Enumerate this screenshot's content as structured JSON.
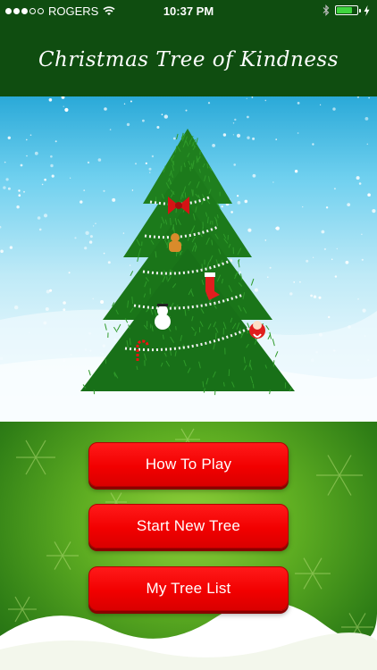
{
  "status_bar": {
    "carrier": "ROGERS",
    "time": "10:37 PM",
    "signal_strength": 3,
    "signal_max": 5,
    "battery_level": 0.75,
    "battery_color": "#3fd53f"
  },
  "header": {
    "title": "Christmas Tree of Kindness",
    "background": "#0f4d10"
  },
  "menu": {
    "how_to_play": "How To Play",
    "start_new_tree": "Start New Tree",
    "my_tree_list": "My Tree List",
    "button_color": "#f20000"
  },
  "illustration": {
    "icons": [
      "tree-icon",
      "bow-icon",
      "gingerbread-icon",
      "stocking-icon",
      "snowman-icon",
      "santa-icon",
      "candy-cane-icon"
    ]
  }
}
